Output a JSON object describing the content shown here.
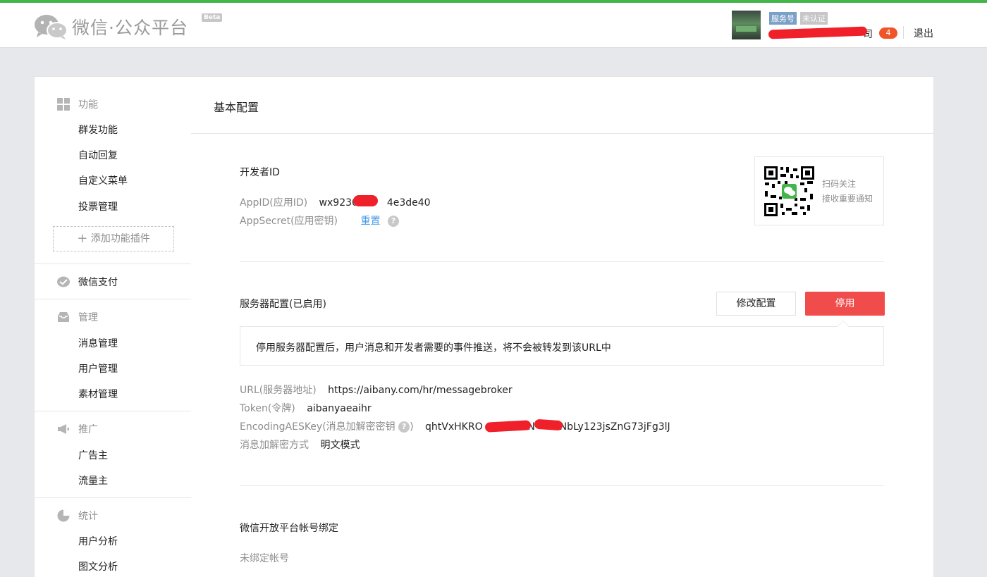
{
  "header": {
    "logo_title": "微信·公众平台",
    "beta": "Beta",
    "account_type": "服务号",
    "verify_status": "未认证",
    "company_suffix": "司",
    "message_count": "4",
    "logout": "退出"
  },
  "sidebar": {
    "groups": [
      {
        "title": "功能",
        "icon": "grid-icon",
        "items": [
          "群发功能",
          "自动回复",
          "自定义菜单",
          "投票管理"
        ]
      },
      {
        "title": "微信支付",
        "icon": "wechat-pay-icon",
        "items": []
      },
      {
        "title": "管理",
        "icon": "inbox-icon",
        "items": [
          "消息管理",
          "用户管理",
          "素材管理"
        ]
      },
      {
        "title": "推广",
        "icon": "megaphone-icon",
        "items": [
          "广告主",
          "流量主"
        ]
      },
      {
        "title": "统计",
        "icon": "pie-chart-icon",
        "items": [
          "用户分析",
          "图文分析"
        ]
      }
    ],
    "add_plugin": "添加功能插件"
  },
  "main": {
    "page_title": "基本配置",
    "developer": {
      "title": "开发者ID",
      "appid_label": "AppID(应用ID)",
      "appid_value": "wx92308",
      "appid_value_tail": "4e3de40",
      "appsecret_label": "AppSecret(应用密钥)",
      "reset_link": "重置",
      "qr_line1": "扫码关注",
      "qr_line2": "接收重要通知"
    },
    "server": {
      "title": "服务器配置(已启用)",
      "modify_button": "修改配置",
      "stop_button": "停用",
      "tip": "停用服务器配置后，用户消息和开发者需要的事件推送，将不会被转发到该URL中",
      "url_label": "URL(服务器地址)",
      "url_value": "https://aibany.com/hr/messagebroker",
      "token_label": "Token(令牌)",
      "token_value": "aibanyaeaihr",
      "aes_label": "EncodingAESKey(消息加解密密钥",
      "aes_label_close": ")",
      "aes_value_head": "qhtVxHKRO",
      "aes_value_mid": "LN",
      "aes_value_tail": "DNbLy123jsZnG73jFg3lJ",
      "mode_label": "消息加解密方式",
      "mode_value": "明文模式"
    },
    "open_platform": {
      "title": "微信开放平台帐号绑定",
      "status": "未绑定帐号"
    }
  }
}
